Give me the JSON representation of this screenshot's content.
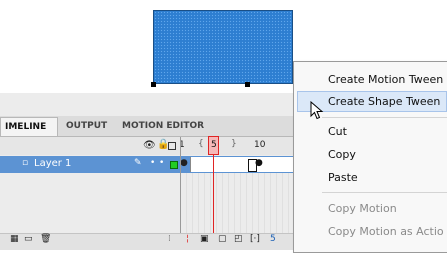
{
  "panel": {
    "tabs": [
      "IMELINE",
      "OUTPUT",
      "MOTION EDITOR"
    ],
    "frame_numbers": [
      "1",
      "5",
      "10"
    ],
    "layer_name": "Layer 1",
    "bottom_frame_number": "5"
  },
  "context_menu": {
    "items": [
      {
        "label": "Create Motion Tween",
        "enabled": true
      },
      {
        "label": "Create Shape Tween",
        "enabled": true,
        "highlighted": true
      },
      {
        "label": "Cut",
        "enabled": true
      },
      {
        "label": "Copy",
        "enabled": true
      },
      {
        "label": "Paste",
        "enabled": true
      },
      {
        "label": "Copy Motion",
        "enabled": false
      },
      {
        "label": "Copy Motion as Actio",
        "enabled": false
      }
    ]
  },
  "colors": {
    "shape_fill": "#2d7ed1",
    "layer_row": "#5c93d3",
    "playhead": "#e02424",
    "menu_highlight": "#dbe8f8"
  }
}
